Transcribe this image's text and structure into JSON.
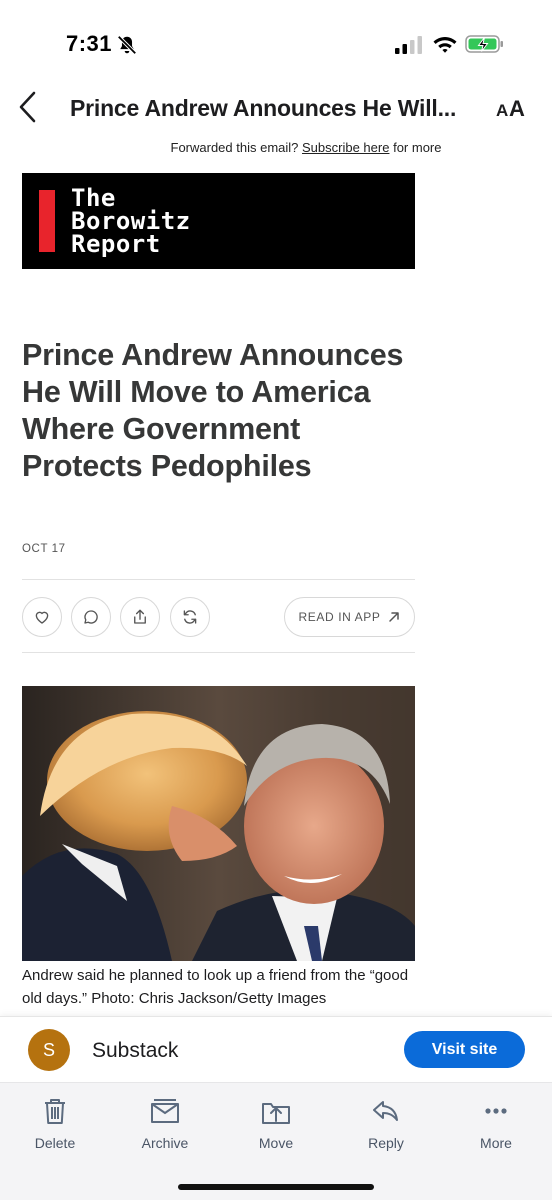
{
  "status_bar": {
    "time": "7:31",
    "icons": [
      "bell-slash-icon",
      "cellular-signal-icon",
      "wifi-icon",
      "battery-charging-icon"
    ]
  },
  "header": {
    "title": "Prince Andrew Announces He Will...",
    "back_icon": "chevron-left-icon",
    "text_size_label": "AA"
  },
  "email": {
    "forwarded_prefix": "Forwarded this email?",
    "subscribe_link": "Subscribe here",
    "forwarded_suffix": "for more",
    "logo_lines": [
      "The",
      "Borowitz",
      "Report"
    ],
    "title": "Prince Andrew Announces He Will Move to America Where Government Protects Pedophiles",
    "date": "OCT 17",
    "actions": [
      "heart-icon",
      "comment-icon",
      "share-icon",
      "restack-icon"
    ],
    "read_in_app": "READ IN APP",
    "caption": "Andrew said he planned to look up a friend from the “good old days.” Photo: Chris Jackson/Getty Images"
  },
  "sender_bar": {
    "avatar_letter": "S",
    "name": "Substack",
    "visit_button": "Visit site",
    "avatar_color": "#b5720f",
    "button_color": "#0b6bd9"
  },
  "toolbar": {
    "items": [
      {
        "label": "Delete",
        "icon": "trash-icon"
      },
      {
        "label": "Archive",
        "icon": "archive-icon"
      },
      {
        "label": "Move",
        "icon": "move-icon"
      },
      {
        "label": "Reply",
        "icon": "reply-icon"
      },
      {
        "label": "More",
        "icon": "more-icon"
      }
    ]
  },
  "colors": {
    "logo_red": "#e8242c",
    "title_text": "#363737"
  }
}
